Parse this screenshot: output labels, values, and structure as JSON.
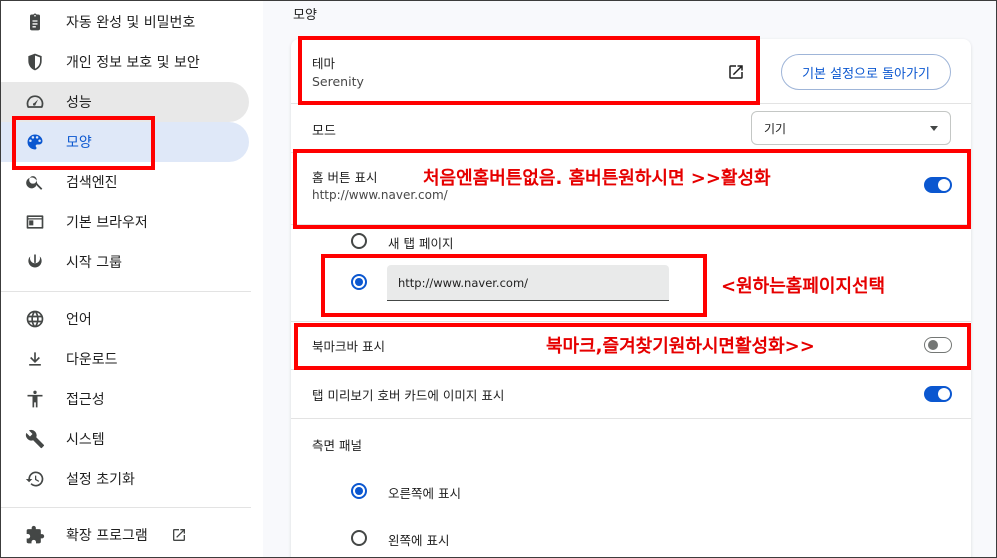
{
  "sidebar": {
    "items": [
      {
        "label": "자동 완성 및 비밀번호"
      },
      {
        "label": "개인 정보 보호 및 보안"
      },
      {
        "label": "성능"
      },
      {
        "label": "모양"
      },
      {
        "label": "검색엔진"
      },
      {
        "label": "기본 브라우저"
      },
      {
        "label": "시작 그룹"
      },
      {
        "label": "언어"
      },
      {
        "label": "다운로드"
      },
      {
        "label": "접근성"
      },
      {
        "label": "시스템"
      },
      {
        "label": "설정 초기화"
      },
      {
        "label": "확장 프로그램"
      }
    ],
    "active_index": 3
  },
  "main": {
    "section_title": "모양",
    "theme": {
      "label": "테마",
      "value": "Serenity",
      "reset_button": "기본 설정으로 돌아가기"
    },
    "mode": {
      "label": "모드",
      "selected": "기기"
    },
    "home_button": {
      "label": "홈 버튼 표시",
      "url": "http://www.naver.com/",
      "enabled": true
    },
    "home_options": {
      "new_tab": "새 탭 페이지",
      "custom_url_value": "http://www.naver.com/",
      "selected": "custom"
    },
    "bookmarks_bar": {
      "label": "북마크바 표시",
      "enabled": false
    },
    "tab_preview": {
      "label": "탭 미리보기 호버 카드에 이미지 표시",
      "enabled": true
    },
    "side_panel": {
      "label": "측면 패널",
      "right": "오른쪽에 표시",
      "left": "왼쪽에 표시",
      "selected": "right"
    }
  },
  "annotations": {
    "home_note": "처음엔홈버튼없음. 홈버튼원하시면 >>활성화",
    "url_note": "<원하는홈페이지선택",
    "bookmark_note": "북마크,즐겨찾기원하시면활성화>>"
  },
  "colors": {
    "accent": "#0b57d0",
    "annotation": "#ff0000",
    "active_bg": "#dfe8f8"
  }
}
